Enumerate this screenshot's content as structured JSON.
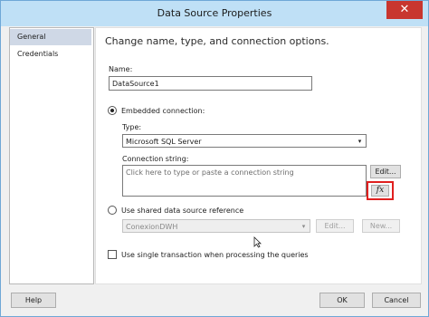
{
  "window": {
    "title": "Data Source Properties",
    "close_glyph": "✕"
  },
  "sidebar": {
    "items": [
      {
        "label": "General"
      },
      {
        "label": "Credentials"
      }
    ]
  },
  "main": {
    "heading": "Change name, type, and connection options.",
    "name_label": "Name:",
    "name_value": "DataSource1",
    "embedded": {
      "radio_label": "Embedded connection:",
      "type_label": "Type:",
      "type_value": "Microsoft SQL Server",
      "conn_label": "Connection string:",
      "conn_placeholder": "Click here to type or paste a connection string",
      "edit_button": "Edit...",
      "fx_label": "fx"
    },
    "shared": {
      "radio_label": "Use shared data source reference",
      "value": "ConexionDWH",
      "edit_button": "Edit...",
      "new_button": "New..."
    },
    "single_tx_label": "Use single transaction when processing the queries"
  },
  "footer": {
    "help": "Help",
    "ok": "OK",
    "cancel": "Cancel"
  },
  "icons": {
    "close": "close-icon",
    "chevron": "chevron-down-icon",
    "fx": "function-icon",
    "cursor": "mouse-cursor-icon"
  },
  "colors": {
    "titlebar": "#bfe0f6",
    "close": "#c8362f",
    "highlight": "#e0201f",
    "selection": "#cfd8e6"
  }
}
